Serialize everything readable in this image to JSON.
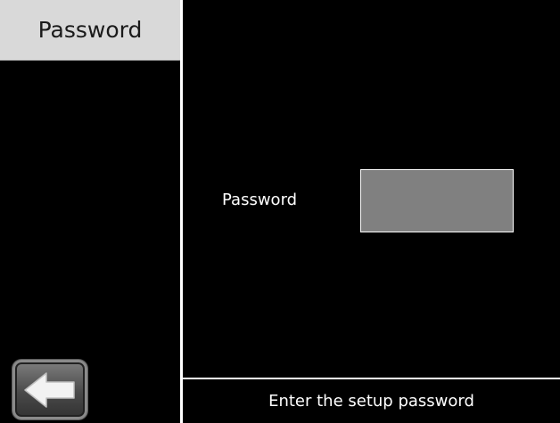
{
  "sidebar": {
    "tab_label": "Password"
  },
  "form": {
    "password_label": "Password",
    "password_value": ""
  },
  "status": {
    "message": "Enter the setup password"
  },
  "icons": {
    "back": "back-arrow-icon"
  },
  "colors": {
    "background": "#000000",
    "tab_background": "#d9d9d9",
    "input_fill": "#808080",
    "text": "#ffffff"
  }
}
